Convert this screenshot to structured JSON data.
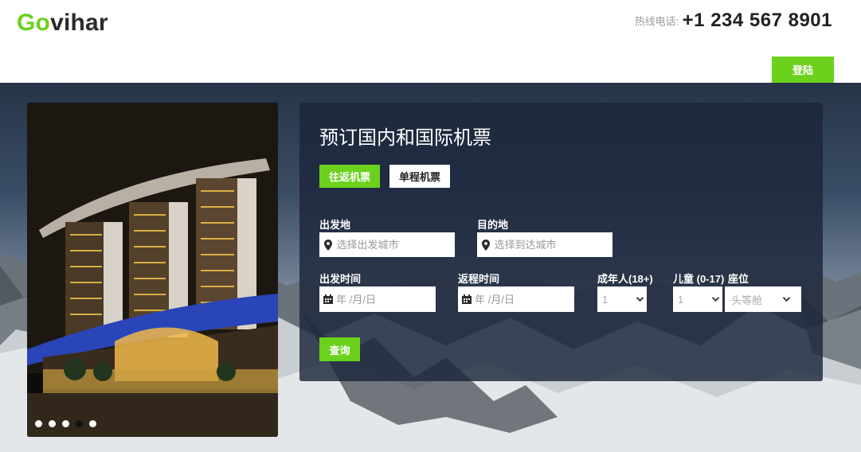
{
  "header": {
    "logo_go": "Go",
    "logo_vihar": "vihar",
    "hotline_label": "热线电话:",
    "hotline_number": "+1 234 567 8901",
    "login_label": "登陆"
  },
  "carousel": {
    "slide_count": 5,
    "active_index": 3
  },
  "booking": {
    "title": "预订国内和国际机票",
    "tabs": [
      {
        "label": "往返机票",
        "active": true
      },
      {
        "label": "单程机票",
        "active": false
      }
    ],
    "from_label": "出发地",
    "from_placeholder": "选择出发城市",
    "to_label": "目的地",
    "to_placeholder": "选择到达城市",
    "depart_label": "出发时间",
    "depart_placeholder": "年 /月/日",
    "return_label": "返程时间",
    "return_placeholder": "年 /月/日",
    "adults_label": "成年人(18+)",
    "adults_value": "1",
    "children_label": "儿童 (0-17)",
    "children_value": "1",
    "class_label": "座位",
    "class_value": "头等舱",
    "search_label": "查询"
  },
  "colors": {
    "accent": "#6bd11d",
    "panel": "#1c263a"
  },
  "icons": [
    "map-marker-icon",
    "calendar-icon",
    "chevron-down-icon"
  ]
}
